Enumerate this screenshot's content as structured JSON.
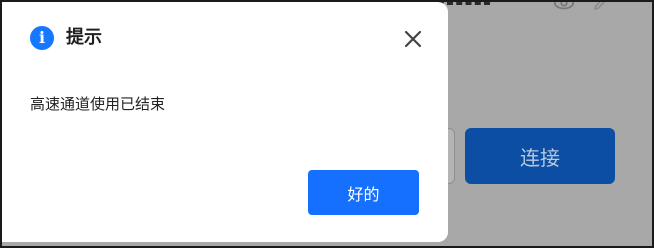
{
  "background": {
    "connect_label": "连接",
    "accent_color": "#0c4ea3"
  },
  "dialog": {
    "title": "提示",
    "info_icon_glyph": "i",
    "message": "高速通道使用已结束",
    "ok_label": "好的",
    "close_icon": "close-icon",
    "ok_color": "#1670ff"
  }
}
